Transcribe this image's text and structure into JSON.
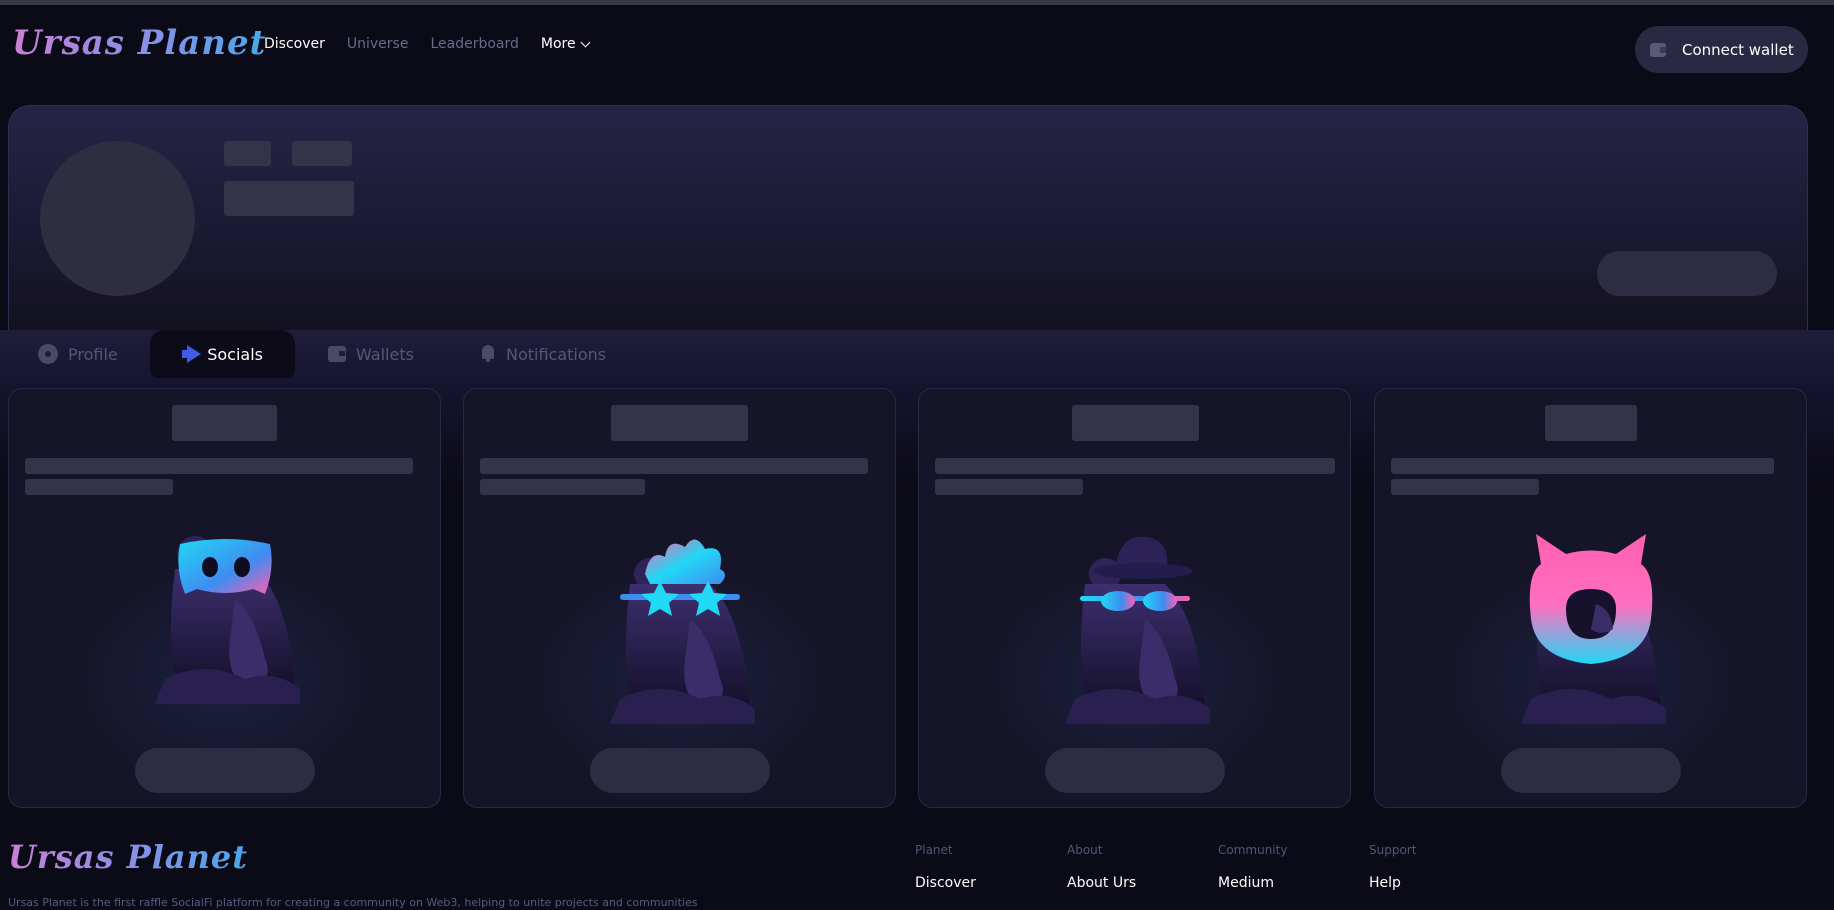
{
  "header": {
    "logo": "Ursas Planet",
    "nav": [
      {
        "label": "Discover",
        "active": true
      },
      {
        "label": "Universe",
        "active": false
      },
      {
        "label": "Leaderboard",
        "active": false
      }
    ],
    "more_label": "More",
    "connect_label": "Connect wallet"
  },
  "tabs": [
    {
      "label": "Profile",
      "icon": "gear-icon",
      "active": false
    },
    {
      "label": "Socials",
      "icon": "megaphone-icon",
      "active": true
    },
    {
      "label": "Wallets",
      "icon": "wallet-icon",
      "active": false
    },
    {
      "label": "Notifications",
      "icon": "bell-icon",
      "active": false
    }
  ],
  "cards": [
    {
      "mascot": "discord-bear"
    },
    {
      "mascot": "star-glasses-bear"
    },
    {
      "mascot": "hat-sunglasses-bear"
    },
    {
      "mascot": "github-cat-bear"
    }
  ],
  "colors": {
    "accent_blue": "#3f5be8",
    "cyan": "#1ee3f2",
    "pink": "#ff5fb0",
    "bear_purple": "#3b2f6b"
  },
  "footer": {
    "logo": "Ursas Planet",
    "description": "Ursas Planet is the first raffle SocialFi platform for creating a community on Web3, helping to unite projects and communities",
    "columns": [
      {
        "heading": "Planet",
        "link": "Discover"
      },
      {
        "heading": "About",
        "link": "About Urs"
      },
      {
        "heading": "Community",
        "link": "Medium"
      },
      {
        "heading": "Support",
        "link": "Help"
      }
    ]
  }
}
